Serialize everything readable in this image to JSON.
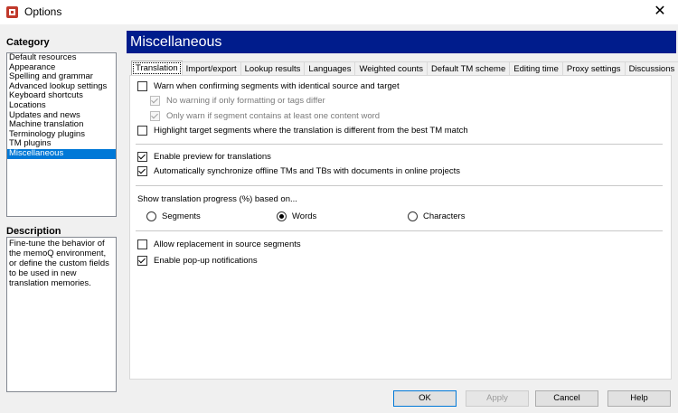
{
  "window": {
    "title": "Options",
    "close_glyph": "✕"
  },
  "category": {
    "heading": "Category",
    "items": [
      "Default resources",
      "Appearance",
      "Spelling and grammar",
      "Advanced lookup settings",
      "Keyboard shortcuts",
      "Locations",
      "Updates and news",
      "Machine translation",
      "Terminology plugins",
      "TM plugins",
      "Miscellaneous"
    ],
    "selected": "Miscellaneous"
  },
  "description": {
    "heading": "Description",
    "text": "Fine-tune the behavior of the memoQ environment, or define the custom fields to be used in new translation memories."
  },
  "header": {
    "title": "Miscellaneous",
    "color": "#001c8c"
  },
  "tabs": [
    "Translation",
    "Import/export",
    "Lookup results",
    "Languages",
    "Weighted counts",
    "Default TM scheme",
    "Editing time",
    "Proxy settings",
    "Discussions"
  ],
  "active_tab": "Translation",
  "options": {
    "warn_identical": {
      "label": "Warn when confirming segments with identical source and target",
      "checked": false
    },
    "no_warning_formatting": {
      "label": "No warning if only formatting or tags differ",
      "checked": true
    },
    "only_warn_content": {
      "label": "Only warn if segment contains at least one content word",
      "checked": true
    },
    "highlight_target": {
      "label": "Highlight target segments where the translation is different from the best TM match",
      "checked": false
    },
    "enable_preview": {
      "label": "Enable preview for translations",
      "checked": true
    },
    "auto_sync": {
      "label": "Automatically synchronize offline TMs and TBs with documents in online projects",
      "checked": true
    },
    "allow_replacement": {
      "label": "Allow replacement in source segments",
      "checked": false
    },
    "enable_popup": {
      "label": "Enable pop-up notifications",
      "checked": true
    }
  },
  "progress": {
    "label": "Show translation progress (%) based on...",
    "choices": [
      "Segments",
      "Words",
      "Characters"
    ],
    "selected": "Words"
  },
  "buttons": {
    "ok": "OK",
    "apply": "Apply",
    "cancel": "Cancel",
    "help": "Help"
  }
}
